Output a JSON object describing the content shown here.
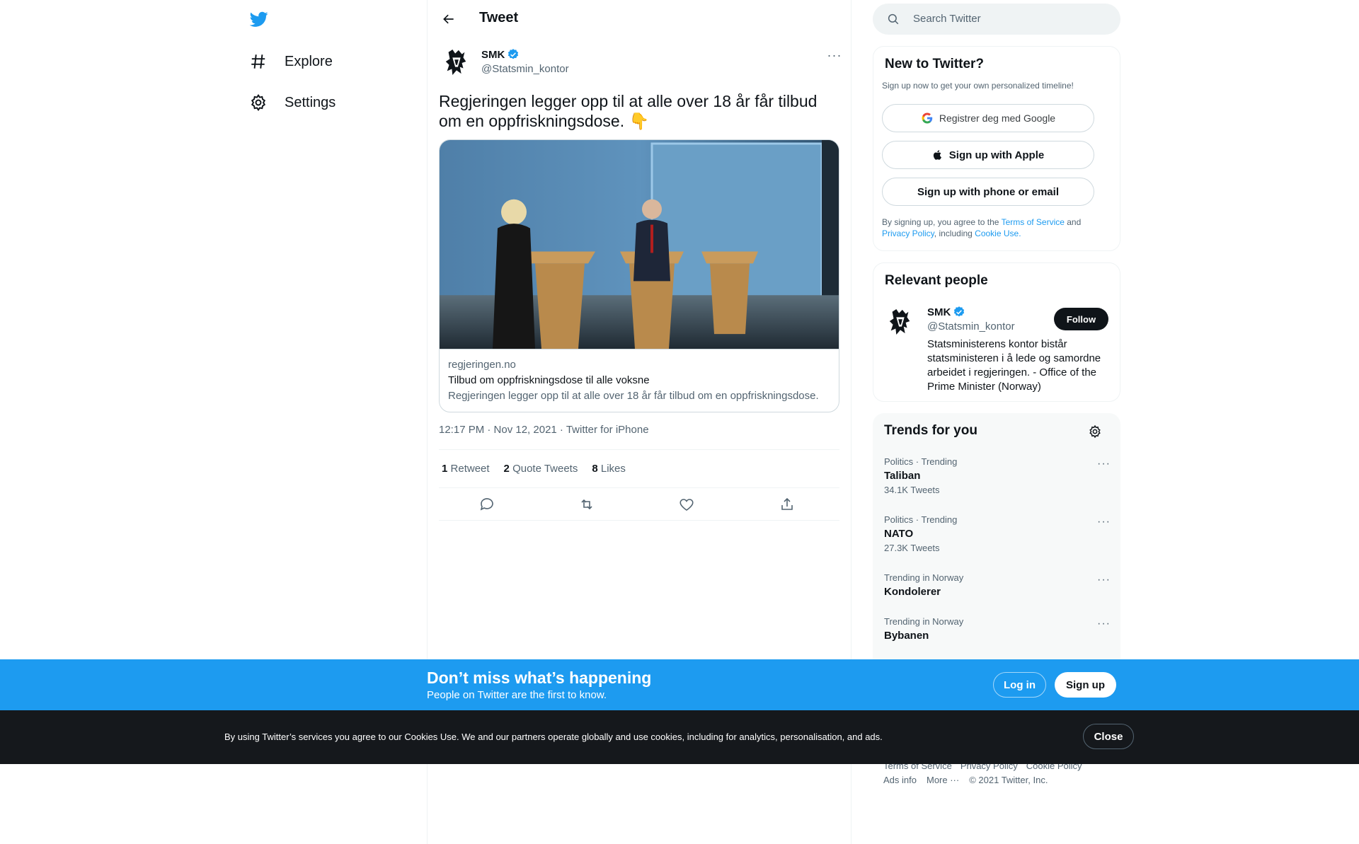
{
  "nav": {
    "items": [
      {
        "label": "Explore",
        "icon": "hashtag-icon"
      },
      {
        "label": "Settings",
        "icon": "gear-icon"
      }
    ]
  },
  "header": {
    "title": "Tweet"
  },
  "tweet": {
    "author_name": "SMK",
    "author_handle": "@Statsmin_kontor",
    "text": "Regjeringen legger opp til at alle over 18 år får tilbud om en oppfriskningsdose. 👇",
    "card": {
      "domain": "regjeringen.no",
      "title": "Tilbud om oppfriskningsdose til alle voksne",
      "description": "Regjeringen legger opp til at alle over 18 år får tilbud om en oppfriskningsdose."
    },
    "meta": "12:17 PM · Nov 12, 2021 · Twitter for iPhone",
    "stats": {
      "retweets_count": "1",
      "retweets_label": "Retweet",
      "quotes_count": "2",
      "quotes_label": "Quote Tweets",
      "likes_count": "8",
      "likes_label": "Likes"
    }
  },
  "search": {
    "placeholder": "Search Twitter"
  },
  "signup_panel": {
    "title": "New to Twitter?",
    "subtitle": "Sign up now to get your own personalized timeline!",
    "google_label": "Registrer deg med Google",
    "apple_label": "Sign up with Apple",
    "phone_label": "Sign up with phone or email",
    "legal_1": "By signing up, you agree to the ",
    "tos": "Terms of Service",
    "legal_2": " and",
    "privacy": "Privacy Policy",
    "legal_3": ", including ",
    "cookie": "Cookie Use."
  },
  "relevant": {
    "title": "Relevant people",
    "name": "SMK",
    "handle": "@Statsmin_kontor",
    "follow_label": "Follow",
    "bio": "Statsministerens kontor bistår statsministeren i å lede og samordne arbeidet i regjeringen. - Office of the Prime Minister (Norway)"
  },
  "trends": {
    "title": "Trends for you",
    "items": [
      {
        "category": "Politics · Trending",
        "name": "Taliban",
        "count": "34.1K Tweets"
      },
      {
        "category": "Politics · Trending",
        "name": "NATO",
        "count": "27.3K Tweets"
      },
      {
        "category": "Trending in Norway",
        "name": "Kondolerer",
        "count": ""
      },
      {
        "category": "Trending in Norway",
        "name": "Bybanen",
        "count": ""
      }
    ]
  },
  "footer": {
    "tos": "Terms of Service",
    "privacy": "Privacy Policy",
    "cookie": "Cookie Policy",
    "ads": "Ads info",
    "more": "More ···",
    "copyright": "© 2021 Twitter, Inc."
  },
  "bottom_bar": {
    "title": "Don’t miss what’s happening",
    "subtitle": "People on Twitter are the first to know.",
    "login": "Log in",
    "signup": "Sign up"
  },
  "cookie_bar": {
    "text": "By using Twitter’s services you agree to our Cookies Use. We and our partners operate globally and use cookies, including for analytics, personalisation, and ads.",
    "close": "Close"
  },
  "colors": {
    "accent": "#1d9bf0",
    "text": "#0f1419",
    "muted": "#536471"
  }
}
